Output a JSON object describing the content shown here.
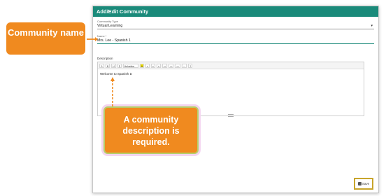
{
  "dialog": {
    "title": "Add/Edit Community"
  },
  "community_type": {
    "label": "Community Type",
    "value": "Virtual Learning"
  },
  "name_field": {
    "label": "Name *",
    "value": "Mrs. Lee - Spanish 1"
  },
  "description": {
    "label": "Description",
    "content": "Welcome to Spanish 1!",
    "toolbar": {
      "font": "Helvetica",
      "buttons": [
        "B",
        "U",
        "¶",
        "A",
        "≡",
        "≡",
        "≡",
        "▭",
        "▭",
        "▭",
        "⋯",
        "?"
      ]
    }
  },
  "save_button": {
    "label": "Save"
  },
  "callouts": {
    "name": "Community name",
    "description": "A community description is required."
  },
  "colors": {
    "header": "#1a8a7a",
    "callout": "#f08a1f",
    "highlight": "#c8a52b"
  }
}
